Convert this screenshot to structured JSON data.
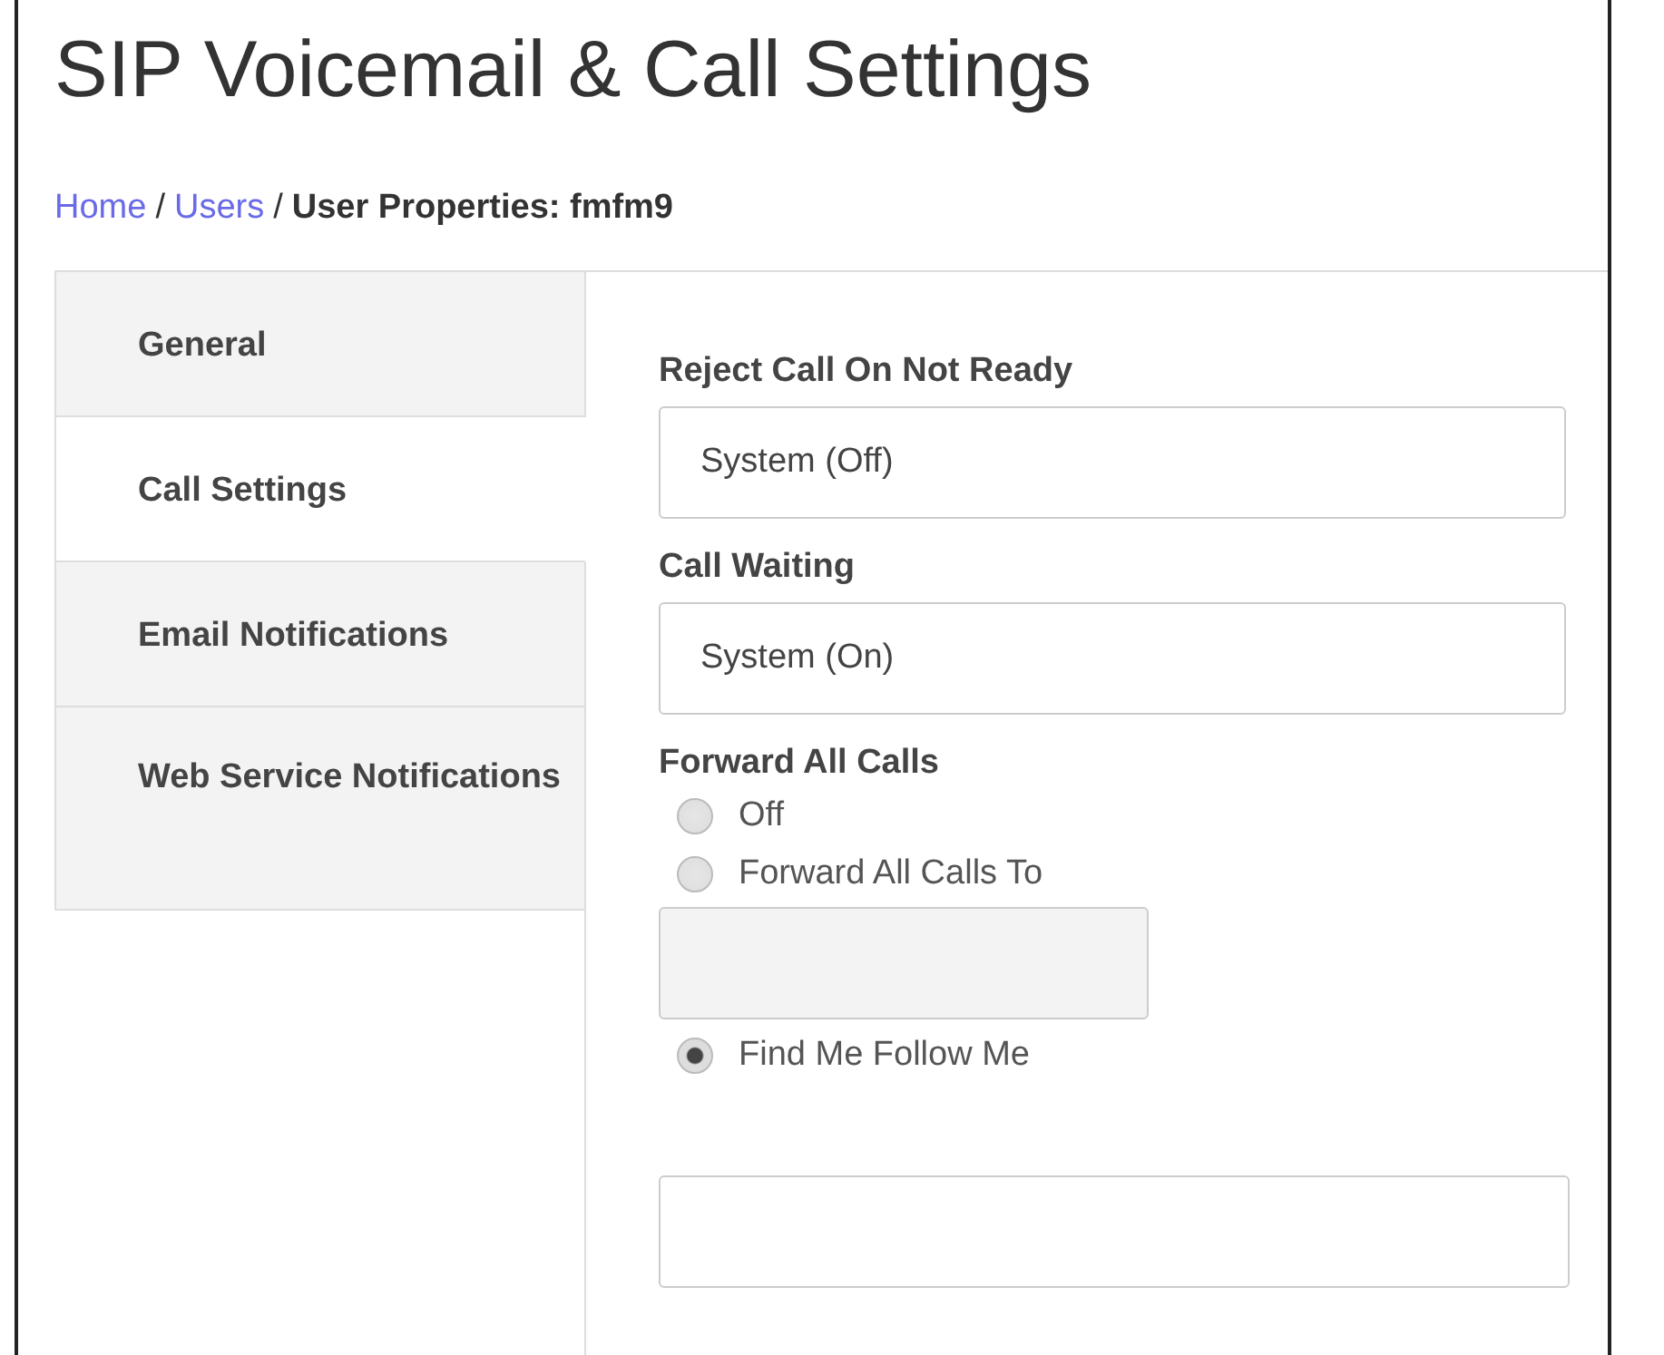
{
  "page": {
    "title": "SIP Voicemail & Call Settings"
  },
  "breadcrumb_separator": "/",
  "breadcrumb": [
    {
      "label": "Home",
      "kind": "link"
    },
    {
      "label": "Users",
      "kind": "link"
    },
    {
      "label": "User Properties: fmfm9",
      "kind": "current"
    }
  ],
  "tabs": [
    {
      "label": "General",
      "selected": false
    },
    {
      "label": "Call Settings",
      "selected": true
    },
    {
      "label": "Email Notifications",
      "selected": false
    },
    {
      "label": "Web Service Notifications",
      "selected": false
    }
  ],
  "fields": [
    {
      "kind": "select",
      "label": "Reject Call On Not Ready",
      "value": "System (Off)"
    },
    {
      "kind": "select",
      "label": "Call Waiting",
      "value": "System (On)"
    },
    {
      "kind": "radio",
      "label": "Forward All Calls",
      "options": [
        {
          "label": "Off",
          "selected": false
        },
        {
          "label": "Forward All Calls To",
          "selected": false,
          "input": true
        },
        {
          "label": "Find Me Follow Me",
          "selected": true
        }
      ]
    }
  ]
}
